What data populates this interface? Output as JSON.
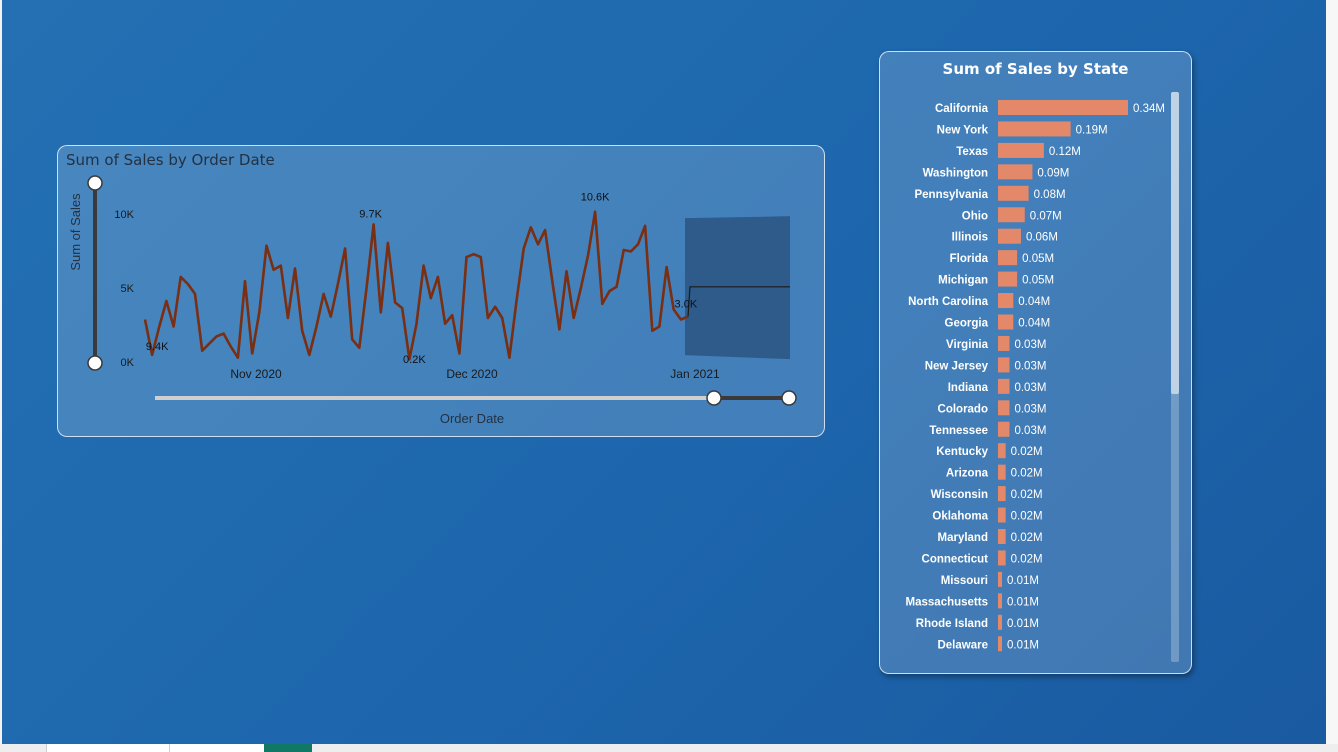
{
  "colors": {
    "line": "#7a2e12",
    "bar": "#e3896a",
    "forecast": "#2c5581",
    "slider": "#cfcfcf",
    "slider_dark": "#3a3a3a"
  },
  "line_chart": {
    "title": "Sum of Sales by Order Date",
    "ylabel": "Sum of Sales",
    "xlabel": "Order Date",
    "y_ticks": [
      "10K",
      "5K",
      "0K"
    ],
    "x_ticks": [
      "Nov 2020",
      "Dec 2020",
      "Jan 2021"
    ],
    "annotations": [
      "9.4K",
      "9.7K",
      "0.2K",
      "10.6K",
      "3.0K"
    ]
  },
  "bar_chart": {
    "title": "Sum of Sales by State"
  },
  "chart_data": [
    {
      "type": "line",
      "title": "Sum of Sales by Order Date",
      "xlabel": "Order Date",
      "ylabel": "Sum of Sales",
      "ylim": [
        0,
        11000
      ],
      "x_ticks": [
        "Nov 2020",
        "Dec 2020",
        "Jan 2021"
      ],
      "values": [
        3000,
        500,
        2500,
        4300,
        2500,
        6000,
        5500,
        4800,
        800,
        1300,
        1800,
        2000,
        1100,
        300,
        5700,
        600,
        3500,
        8200,
        6500,
        6800,
        3100,
        6600,
        2200,
        500,
        2500,
        4800,
        3200,
        5500,
        8000,
        1600,
        1000,
        5200,
        9700,
        3500,
        8400,
        4200,
        3800,
        200,
        2700,
        6800,
        4500,
        6000,
        2700,
        3300,
        600,
        7400,
        7600,
        7400,
        3100,
        3900,
        3100,
        300,
        4300,
        8000,
        9500,
        8300,
        9300,
        5700,
        2300,
        6400,
        3100,
        5200,
        7500,
        10600,
        4100,
        5000,
        5300,
        7900,
        7800,
        8300,
        9600,
        2200,
        2500,
        6700,
        3700,
        3000,
        3200
      ],
      "annotations": [
        {
          "label": "9.4K"
        },
        {
          "label": "9.7K"
        },
        {
          "label": "0.2K"
        },
        {
          "label": "10.6K"
        },
        {
          "label": "3.0K"
        }
      ],
      "forecast": {
        "value": 5300,
        "upper": 10000,
        "lower": 200
      }
    },
    {
      "type": "bar",
      "orientation": "horizontal",
      "title": "Sum of Sales by State",
      "categories": [
        "California",
        "New York",
        "Texas",
        "Washington",
        "Pennsylvania",
        "Ohio",
        "Illinois",
        "Florida",
        "Michigan",
        "North Carolina",
        "Georgia",
        "Virginia",
        "New Jersey",
        "Indiana",
        "Colorado",
        "Tennessee",
        "Kentucky",
        "Arizona",
        "Wisconsin",
        "Oklahoma",
        "Maryland",
        "Connecticut",
        "Missouri",
        "Massachusetts",
        "Rhode Island",
        "Delaware"
      ],
      "values": [
        0.34,
        0.19,
        0.12,
        0.09,
        0.08,
        0.07,
        0.06,
        0.05,
        0.05,
        0.04,
        0.04,
        0.03,
        0.03,
        0.03,
        0.03,
        0.03,
        0.02,
        0.02,
        0.02,
        0.02,
        0.02,
        0.02,
        0.01,
        0.01,
        0.01,
        0.01
      ],
      "labels": [
        "0.34M",
        "0.19M",
        "0.12M",
        "0.09M",
        "0.08M",
        "0.07M",
        "0.06M",
        "0.05M",
        "0.05M",
        "0.04M",
        "0.04M",
        "0.03M",
        "0.03M",
        "0.03M",
        "0.03M",
        "0.03M",
        "0.02M",
        "0.02M",
        "0.02M",
        "0.02M",
        "0.02M",
        "0.02M",
        "0.01M",
        "0.01M",
        "0.01M",
        "0.01M"
      ]
    }
  ]
}
